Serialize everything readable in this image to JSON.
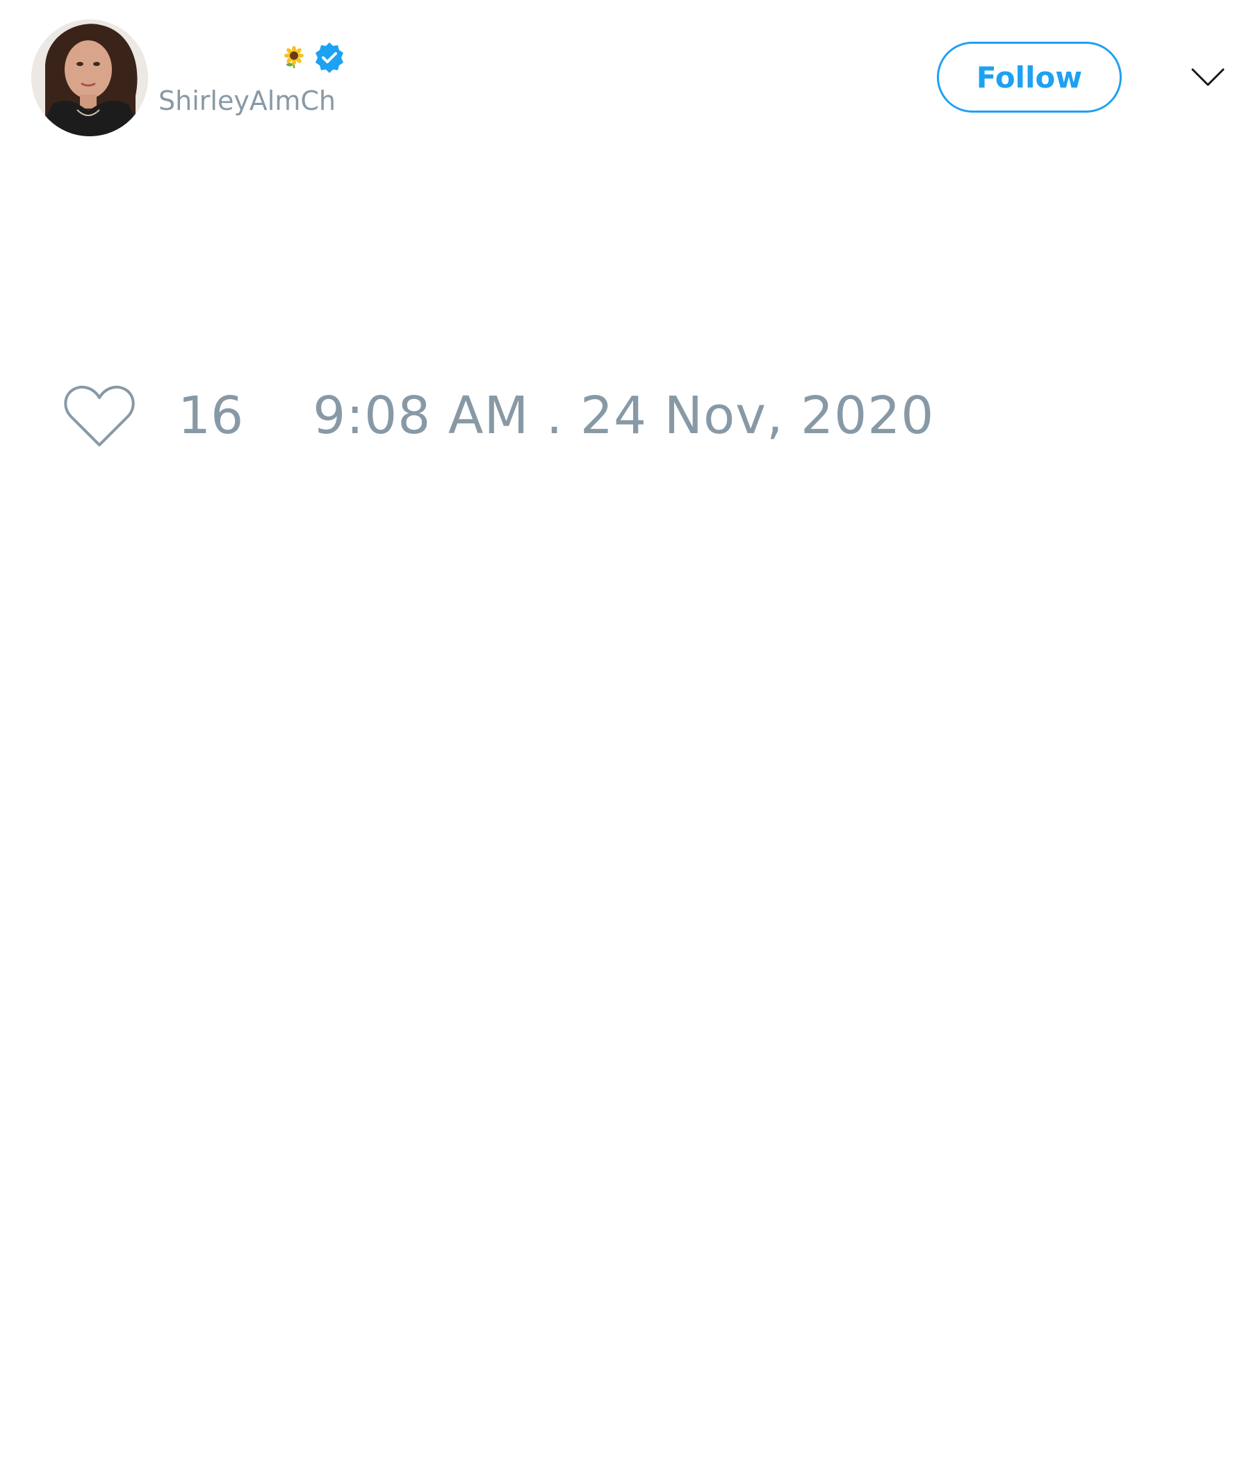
{
  "tweet": {
    "author": {
      "display_name": "",
      "name_emoji": "sunflower-icon",
      "verified": true,
      "verified_icon": "verified-badge-icon",
      "handle": "ShirleyAlmCh",
      "avatar": "profile-photo"
    },
    "actions": {
      "follow_label": "Follow",
      "more_icon": "chevron-down-icon"
    },
    "footer": {
      "like_icon": "heart-outline-icon",
      "like_count": "16",
      "timestamp": "9:08 AM . 24 Nov, 2020"
    }
  },
  "colors": {
    "accent": "#1da1f2",
    "muted_text": "#8899a6",
    "background": "#ffffff"
  }
}
